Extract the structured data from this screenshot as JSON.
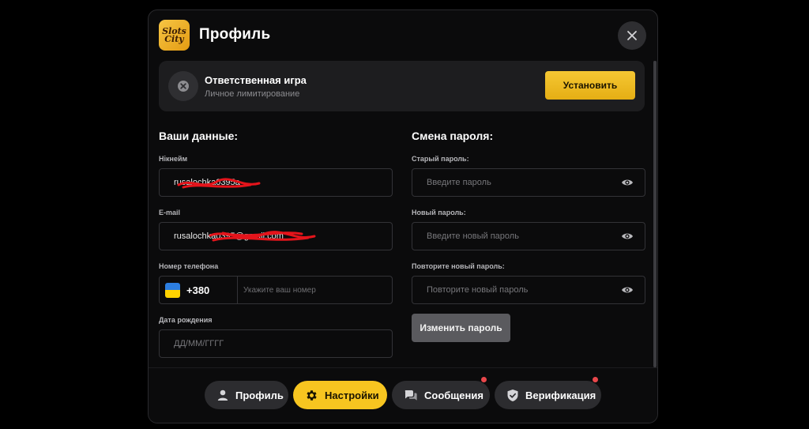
{
  "header": {
    "logo_line1": "Slots",
    "logo_line2": "City",
    "title": "Профиль"
  },
  "responsible_game": {
    "title": "Ответственная игра",
    "subtitle": "Личное лимитирование",
    "button_label": "Установить"
  },
  "your_data": {
    "section_title": "Ваши данные:",
    "nickname_label": "Нікнейм",
    "nickname_value": "rusalochka0395a",
    "email_label": "E-mail",
    "email_value": "rusalochka0395@gmail.com",
    "phone_label": "Номер телефона",
    "phone_code": "+380",
    "phone_placeholder": "Укажите ваш номер",
    "birth_label": "Дата рождения",
    "birth_placeholder": "ДД/ММ/ГГГГ"
  },
  "password": {
    "section_title": "Смена пароля:",
    "old_label": "Старый пароль:",
    "old_placeholder": "Введите пароль",
    "new_label": "Новый пароль:",
    "new_placeholder": "Введите новый пароль",
    "repeat_label": "Повторите новый пароль:",
    "repeat_placeholder": "Повторите новый пароль",
    "change_button": "Изменить пароль"
  },
  "footer_nav": [
    {
      "label": "Профиль",
      "icon": "user-icon",
      "active": false,
      "notification": false
    },
    {
      "label": "Настройки",
      "icon": "gear-icon",
      "active": true,
      "notification": false
    },
    {
      "label": "Сообщения",
      "icon": "chat-icon",
      "active": false,
      "notification": true
    },
    {
      "label": "Верификация",
      "icon": "shield-check-icon",
      "active": false,
      "notification": true
    }
  ],
  "colors": {
    "accent": "#f7c520",
    "notification": "#e8474b",
    "background": "#0b0b0c",
    "card": "#1d1d1f"
  }
}
